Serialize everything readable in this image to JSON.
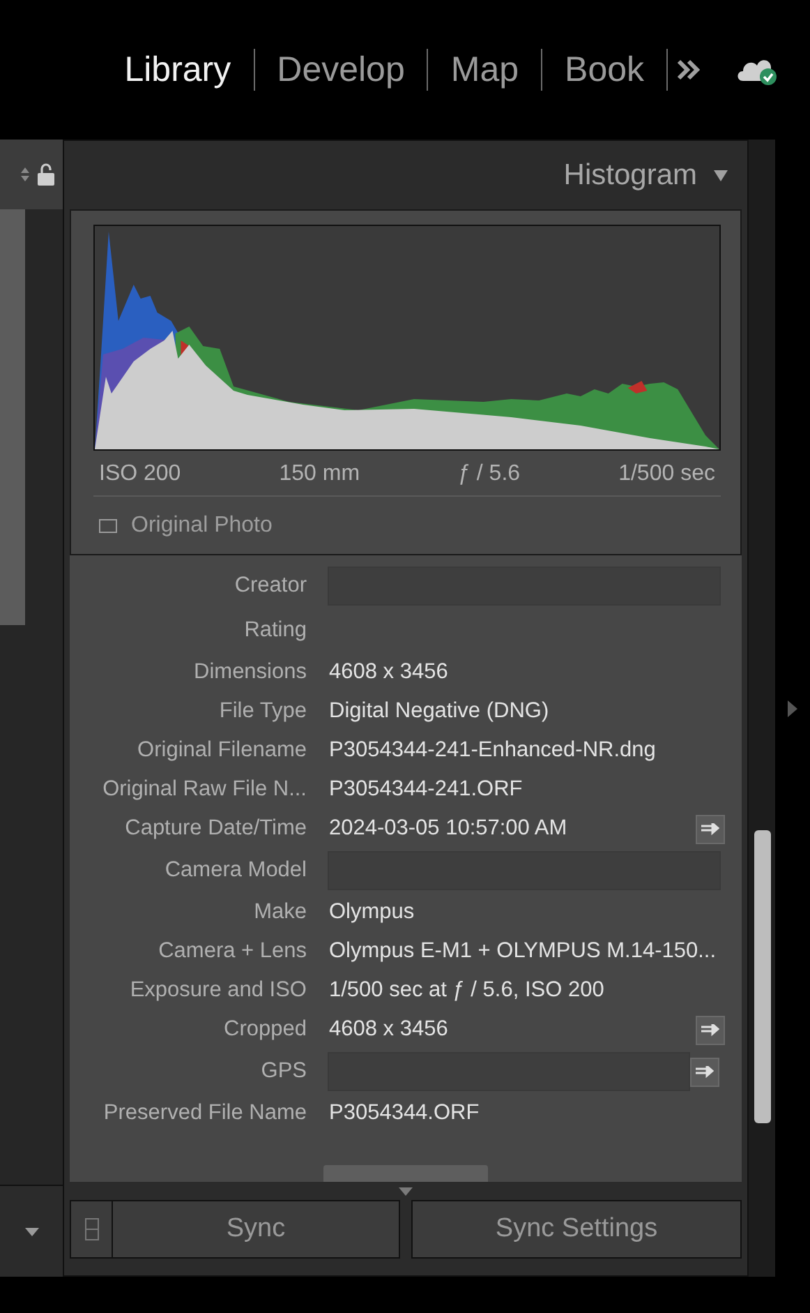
{
  "modules": [
    {
      "label": "Library",
      "selected": true
    },
    {
      "label": "Develop",
      "selected": false
    },
    {
      "label": "Map",
      "selected": false
    },
    {
      "label": "Book",
      "selected": false
    }
  ],
  "histogram": {
    "title": "Histogram",
    "info": [
      "ISO 200",
      "150 mm",
      "ƒ / 5.6",
      "1/500 sec"
    ],
    "original_photo": {
      "label": "Original Photo",
      "checked": false
    }
  },
  "metadata": [
    {
      "label": "Creator",
      "kind": "field"
    },
    {
      "label": "Rating",
      "kind": "empty"
    },
    {
      "label": "Dimensions",
      "kind": "text",
      "value": "4608 x 3456"
    },
    {
      "label": "File Type",
      "kind": "text",
      "value": "Digital Negative (DNG)"
    },
    {
      "label": "Original Filename",
      "kind": "text",
      "value": "P3054344-241-Enhanced-NR.dng"
    },
    {
      "label": "Original Raw File N...",
      "kind": "text",
      "value": "P3054344-241.ORF"
    },
    {
      "label": "Capture Date/Time",
      "kind": "text_button",
      "value": "2024-03-05 10:57:00 AM"
    },
    {
      "label": "Camera Model",
      "kind": "field"
    },
    {
      "label": "Make",
      "kind": "text",
      "value": "Olympus"
    },
    {
      "label": "Camera + Lens",
      "kind": "text",
      "value": "Olympus E-M1 + OLYMPUS M.14-150..."
    },
    {
      "label": "Exposure and ISO",
      "kind": "text",
      "value": "1/500 sec at ƒ / 5.6, ISO 200"
    },
    {
      "label": "Cropped",
      "kind": "text_button",
      "value": "4608 x 3456"
    },
    {
      "label": "GPS",
      "kind": "field_button"
    },
    {
      "label": "Preserved File Name",
      "kind": "text",
      "value": "P3054344.ORF"
    }
  ],
  "buttons": [
    {
      "label": "Sync"
    },
    {
      "label": "Sync Settings"
    }
  ]
}
